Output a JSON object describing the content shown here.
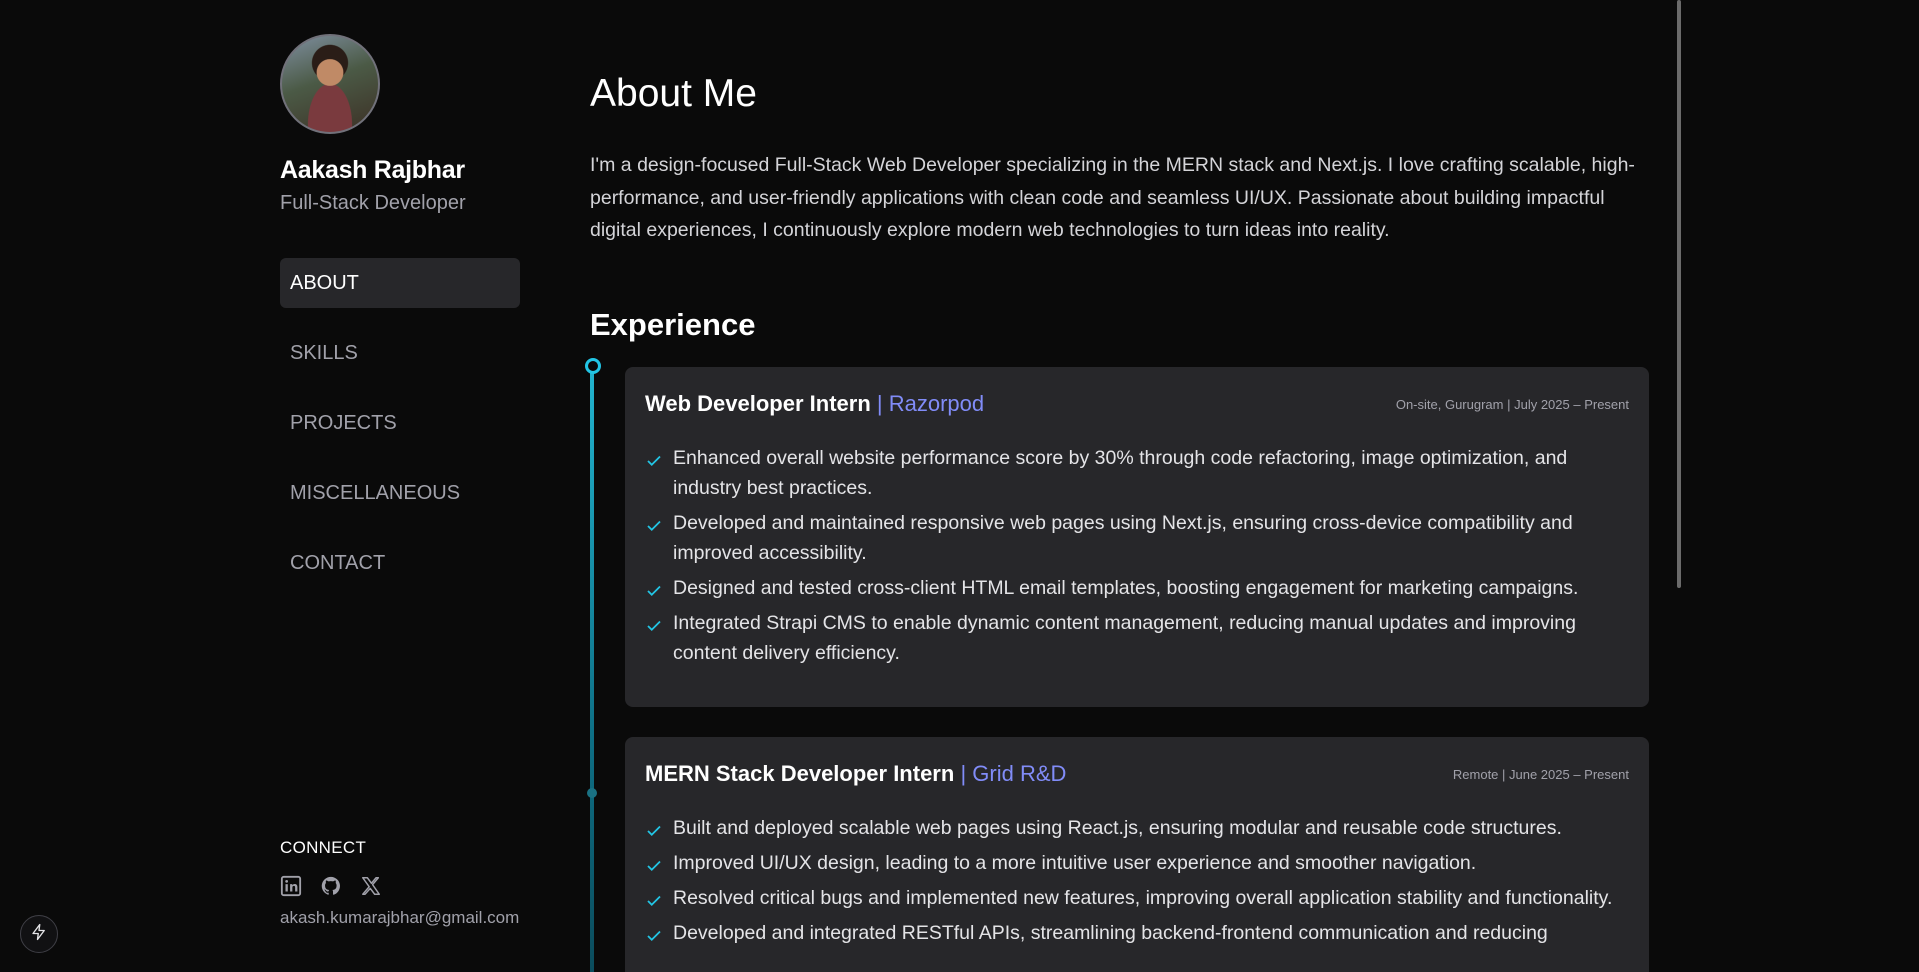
{
  "profile": {
    "name": "Aakash Rajbhar",
    "role": "Full-Stack Developer"
  },
  "nav": {
    "items": [
      {
        "label": "ABOUT",
        "active": true
      },
      {
        "label": "SKILLS",
        "active": false
      },
      {
        "label": "PROJECTS",
        "active": false
      },
      {
        "label": "MISCELLANEOUS",
        "active": false
      },
      {
        "label": "CONTACT",
        "active": false
      }
    ]
  },
  "connect": {
    "label": "CONNECT",
    "icons": [
      "linkedin-icon",
      "github-icon",
      "x-icon"
    ],
    "email": "akash.kumarajbhar@gmail.com"
  },
  "about": {
    "title": "About Me",
    "text": "I'm a design-focused Full-Stack Web Developer specializing in the MERN stack and Next.js. I love crafting scalable, high-performance, and user-friendly applications with clean code and seamless UI/UX. Passionate about building impactful digital experiences, I continuously explore modern web technologies to turn ideas into reality."
  },
  "experience": {
    "title": "Experience",
    "jobs": [
      {
        "title": "Web Developer Intern",
        "company": "| Razorpod",
        "meta": "On-site, Gurugram | July 2025 – Present",
        "bullets": [
          "Enhanced overall website performance score by 30% through code refactoring, image optimization, and industry best practices.",
          "Developed and maintained responsive web pages using Next.js, ensuring cross-device compatibility and improved accessibility.",
          "Designed and tested cross-client HTML email templates, boosting engagement for marketing campaigns.",
          "Integrated Strapi CMS to enable dynamic content management, reducing manual updates and improving content delivery efficiency."
        ]
      },
      {
        "title": "MERN Stack Developer Intern",
        "company": "| Grid R&D",
        "meta": "Remote | June 2025 – Present",
        "bullets": [
          "Built and deployed scalable web pages using React.js, ensuring modular and reusable code structures.",
          "Improved UI/UX design, leading to a more intuitive user experience and smoother navigation.",
          "Resolved critical bugs and implemented new features, improving overall application stability and functionality.",
          "Developed and integrated RESTful APIs, streamlining backend-frontend communication and reducing"
        ]
      }
    ]
  },
  "colors": {
    "accent": "#22c5e5",
    "company": "#818cf8",
    "background": "#0a0a0a",
    "card": "#27272a"
  }
}
